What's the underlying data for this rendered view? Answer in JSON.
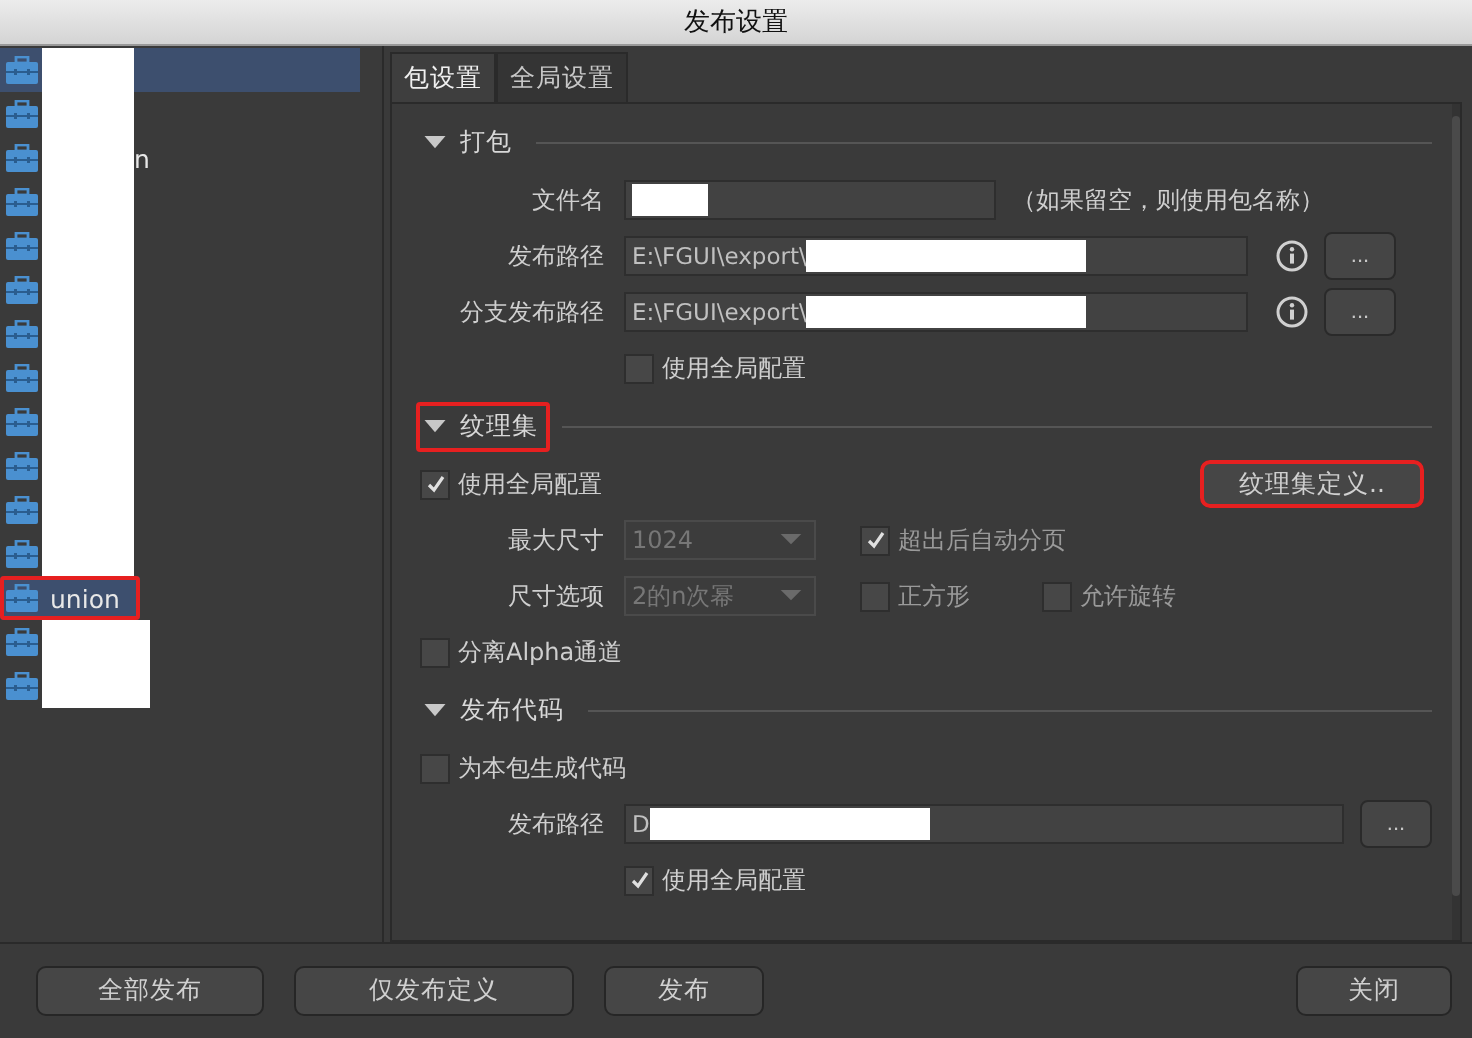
{
  "window": {
    "title": "发布设置"
  },
  "packages": [
    {
      "kind": "hidden",
      "selected": true,
      "highlighted": false
    },
    {
      "kind": "hidden",
      "selected": false,
      "highlighted": false
    },
    {
      "kind": "partial",
      "label": "n",
      "selected": false,
      "highlighted": false
    },
    {
      "kind": "hidden",
      "selected": false,
      "highlighted": false
    },
    {
      "kind": "hidden",
      "selected": false,
      "highlighted": false
    },
    {
      "kind": "hidden",
      "selected": false,
      "highlighted": false
    },
    {
      "kind": "hidden",
      "selected": false,
      "highlighted": false
    },
    {
      "kind": "hidden",
      "selected": false,
      "highlighted": false
    },
    {
      "kind": "hidden",
      "selected": false,
      "highlighted": false
    },
    {
      "kind": "hidden",
      "selected": false,
      "highlighted": false
    },
    {
      "kind": "hidden",
      "selected": false,
      "highlighted": false
    },
    {
      "kind": "hidden",
      "selected": false,
      "highlighted": false
    },
    {
      "kind": "named",
      "label": "union",
      "selected": true,
      "highlighted": true
    },
    {
      "kind": "hidden",
      "selected": false,
      "highlighted": false
    },
    {
      "kind": "hidden",
      "selected": false,
      "highlighted": false
    }
  ],
  "tabs": [
    {
      "label": "包设置",
      "selected": true
    },
    {
      "label": "全局设置",
      "selected": false
    }
  ],
  "sections": [
    {
      "title": "打包",
      "expanded": true,
      "highlighted": false,
      "rows": [
        {
          "kind": "field",
          "label": "文件名",
          "value": "",
          "redacted": true,
          "note": "（如果留空，则使用包名称）"
        },
        {
          "kind": "field",
          "label": "发布路径",
          "value": "E:\\FGUI\\export\\",
          "redacted": true,
          "info": true,
          "browse": "..."
        },
        {
          "kind": "field",
          "label": "分支发布路径",
          "value": "E:\\FGUI\\export\\",
          "redacted": true,
          "info": true,
          "browse": "..."
        },
        {
          "kind": "sub_check",
          "label": "使用全局配置",
          "checked": false
        }
      ]
    },
    {
      "title": "纹理集",
      "expanded": true,
      "highlighted": true,
      "rows": [
        {
          "kind": "check_button",
          "label": "使用全局配置",
          "checked": true,
          "button": {
            "label": "纹理集定义..",
            "highlighted": true
          }
        },
        {
          "kind": "select",
          "label": "最大尺寸",
          "value": "1024",
          "disabled": true,
          "checks": [
            {
              "label": "超出后自动分页",
              "checked": true
            }
          ]
        },
        {
          "kind": "select",
          "label": "尺寸选项",
          "value": "2的n次幂",
          "disabled": true,
          "checks": [
            {
              "label": "正方形",
              "checked": false
            },
            {
              "label": "允许旋转",
              "checked": false
            }
          ]
        },
        {
          "kind": "check",
          "label": "分离Alpha通道",
          "checked": false
        }
      ]
    },
    {
      "title": "发布代码",
      "expanded": true,
      "highlighted": false,
      "rows": [
        {
          "kind": "check",
          "label": "为本包生成代码",
          "checked": false
        },
        {
          "kind": "field",
          "label": "发布路径",
          "value": "D",
          "redacted": true,
          "wide": true,
          "browse": "..."
        },
        {
          "kind": "sub_check",
          "label": "使用全局配置",
          "checked": true
        }
      ]
    }
  ],
  "buttons": [
    {
      "label": "全部发布",
      "kind": "left"
    },
    {
      "label": "仅发布定义",
      "kind": "left"
    },
    {
      "label": "发布",
      "kind": "left"
    },
    {
      "label": "关闭",
      "kind": "right"
    }
  ]
}
